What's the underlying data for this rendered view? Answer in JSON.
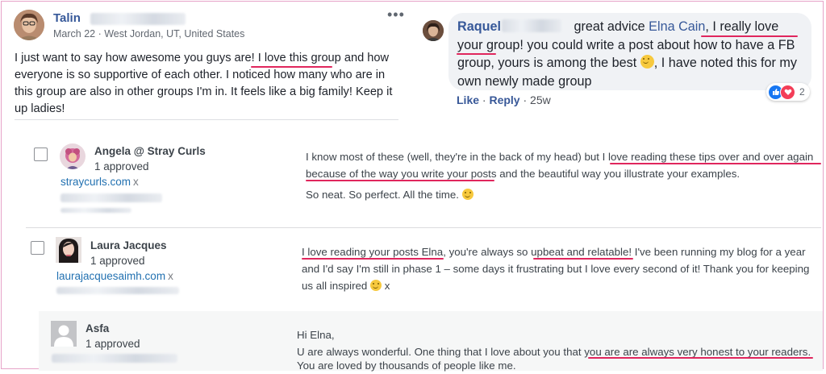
{
  "fb_post": {
    "author": "Talin",
    "meta": "March 22 · West Jordan, UT, United States",
    "menu_glyph": "•••",
    "body_pre": "I just want to say how awesome you guys are! ",
    "body_highlight": "I love this group",
    "body_post": " and how everyone is so supportive of each other. I noticed how many who are in this group are also in other groups I'm in. It feels like a big family! Keep it up ladies!"
  },
  "fb_comment": {
    "author": "Raquel",
    "text_pre": " great advice ",
    "mention": "Elna Cain",
    "text_mid": ", ",
    "highlight": "I really love your group!",
    "text_post": " you could write a post about how to have a FB group, yours is among the best ",
    "text_end": ", I have noted this for my own newly made group",
    "like_label": "Like",
    "reply_label": "Reply",
    "time": "25w",
    "reaction_count": "2",
    "separator": " · "
  },
  "wp_comments": [
    {
      "author": "Angela @ Stray Curls",
      "approved": "1 approved",
      "site": "straycurls.com",
      "remove": "x",
      "line1_pre": "I know most of these (well, they're in the back of my head) but ",
      "line1_hl": "I love reading these tips over and over again",
      "line2_hl": "because of the way you write your posts",
      "line2_post": " and the beautiful way you illustrate your examples.",
      "line3": "So neat. So perfect. All the time."
    },
    {
      "author": "Laura Jacques",
      "approved": "1 approved",
      "site": "laurajacquesaimh.com",
      "remove": "x",
      "line1_hl": "I love reading your posts Elna",
      "line1_mid": ", you're always so ",
      "line1_hl2": "upbeat and relatable",
      "line1_post": "! I've been running my blog for a year",
      "line2": "and I'd say I'm still in phase 1 – some days it frustrating but I love every second of it! Thank you for keeping",
      "line3": "us all inspired",
      "line3_post": "x"
    },
    {
      "author": "Asfa",
      "approved": "1 approved",
      "line1": "Hi Elna,",
      "line2_pre": "U are always wonderful. One thing that I love about you that ",
      "line2_hl": "you are are always very honest to your readers",
      "line2_post": ".",
      "line3": "You are loved by thousands of people like me."
    }
  ],
  "colors": {
    "fb_link": "#365899",
    "wp_link": "#2271b1",
    "underline": "#e0265d",
    "frame": "#e6a3c8"
  },
  "icons": {
    "post_menu": "more-horizontal-icon",
    "like_reaction": "thumbs-up-icon",
    "love_reaction": "heart-icon",
    "emoji": "smiley-emoji-icon"
  }
}
